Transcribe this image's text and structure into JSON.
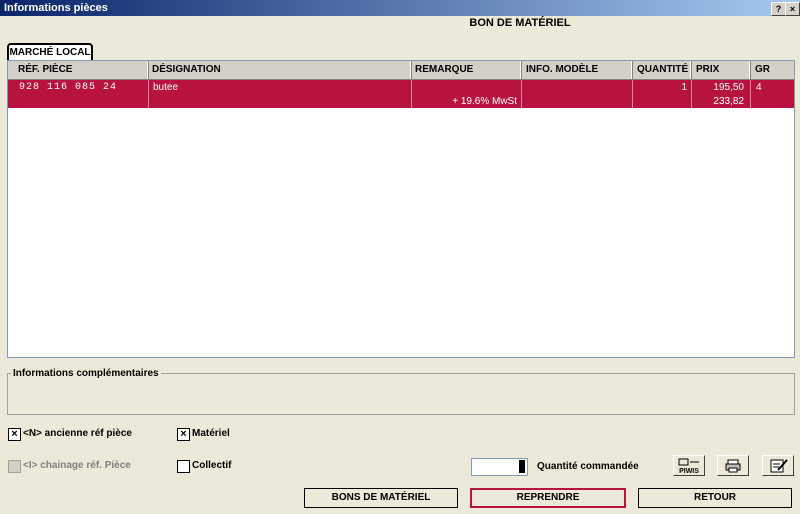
{
  "window": {
    "title": "Informations pièces",
    "help_glyph": "?",
    "close_glyph": "×"
  },
  "heading": "BON DE MATÉRIEL",
  "tab": {
    "label": "MARCHÉ LOCAL"
  },
  "table": {
    "columns": [
      "RÉF. PIÈCE",
      "DÉSIGNATION",
      "REMARQUE",
      "INFO. MODÈLE",
      "QUANTITÉ",
      "PRIX",
      "GR"
    ],
    "rows": [
      {
        "ref": "928 116 085 24",
        "designation": "butee",
        "remarque": "+ 19.6% MwSt",
        "info_modele": "",
        "quantite": "1",
        "prix": "195,50",
        "prix_ttc": "233,82",
        "gr": "4"
      }
    ],
    "row_color": "#b8133e"
  },
  "info": {
    "label": "Informations complémentaires"
  },
  "checkboxes": {
    "ancienne": {
      "label": "<N> ancienne réf pièce",
      "mark": "×"
    },
    "chainage": {
      "label": "<I> chainage réf. Pièce",
      "mark": ""
    },
    "materiel": {
      "label": "Matériel",
      "mark": "×"
    },
    "collectif": {
      "label": "Collectif",
      "mark": ""
    }
  },
  "quantity": {
    "label": "Quantité commandée",
    "value": ""
  },
  "icons": {
    "piwis": "PIWIS",
    "print": "printer-icon",
    "edit": "edit-icon"
  },
  "buttons": {
    "bons": "BONS DE MATÉRIEL",
    "reprendre": "REPRENDRE",
    "retour": "RETOUR"
  }
}
